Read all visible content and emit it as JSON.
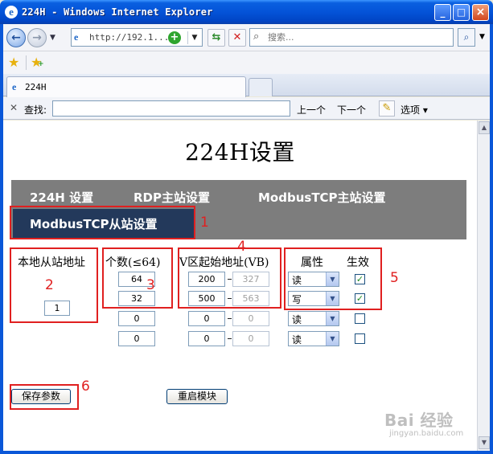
{
  "window": {
    "title": "224H - Windows Internet Explorer",
    "min_glyph": "_",
    "max_glyph": "□",
    "close_glyph": "×"
  },
  "address_bar": {
    "url": "http://192.1...",
    "search_placeholder": "搜索..."
  },
  "tab": {
    "label": "224H"
  },
  "find_bar": {
    "label": "查找:",
    "prev": "上一个",
    "next": "下一个",
    "options": "选项 ▾"
  },
  "page": {
    "title": "224H设置",
    "nav": {
      "item1": "224H 设置",
      "item2": "RDP主站设置",
      "item3": "ModbusTCP主站设置",
      "item4_active": "ModbusTCP从站设置"
    },
    "headers": {
      "local_address": "本地从站地址",
      "count": "个数(≤64)",
      "v_start": "V区起始地址(VB)",
      "attribute": "属性",
      "enable": "生效"
    },
    "local_address_value": "1",
    "rows": [
      {
        "count": "64",
        "v_start": "200",
        "v_end": "327",
        "attr": "读",
        "enabled": true
      },
      {
        "count": "32",
        "v_start": "500",
        "v_end": "563",
        "attr": "写",
        "enabled": true
      },
      {
        "count": "0",
        "v_start": "0",
        "v_end": "0",
        "attr": "读",
        "enabled": false
      },
      {
        "count": "0",
        "v_start": "0",
        "v_end": "0",
        "attr": "读",
        "enabled": false
      }
    ],
    "buttons": {
      "save": "保存参数",
      "restart": "重启模块"
    },
    "annotations": [
      "1",
      "2",
      "3",
      "4",
      "5",
      "6"
    ]
  },
  "watermark": {
    "logo": "Bai 经验",
    "url": "jingyan.baidu.com"
  },
  "colors": {
    "nav_band": "#7d7d7d",
    "nav_active": "#23395b",
    "annotation_red": "#e02020"
  }
}
